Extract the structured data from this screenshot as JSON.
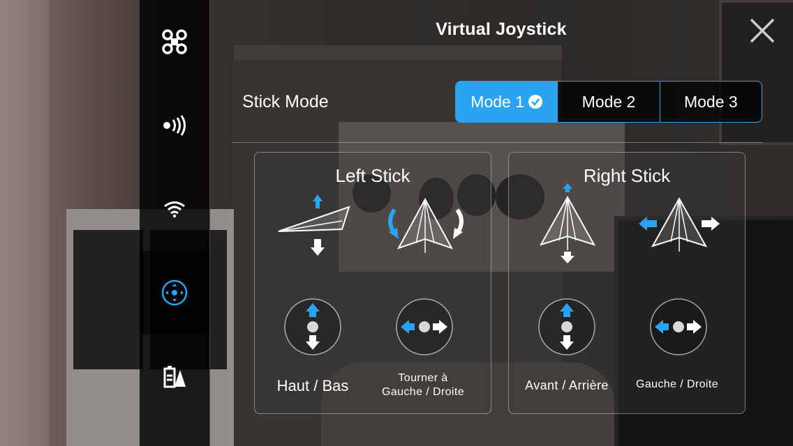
{
  "header": {
    "title": "Virtual Joystick"
  },
  "stick_mode": {
    "label": "Stick Mode",
    "options": [
      "Mode 1",
      "Mode 2",
      "Mode 3"
    ],
    "selected": "Mode 1"
  },
  "left_stick": {
    "title": "Left Stick",
    "vertical_label": "Haut / Bas",
    "horizontal_label_line1": "Tourner à",
    "horizontal_label_line2": "Gauche / Droite"
  },
  "right_stick": {
    "title": "Right Stick",
    "vertical_label": "Avant / Arrière",
    "horizontal_label": "Gauche / Droite"
  },
  "sidebar": {
    "items": [
      {
        "icon": "drone-icon"
      },
      {
        "icon": "signal-icon"
      },
      {
        "icon": "wifi-icon"
      },
      {
        "icon": "joystick-icon",
        "active": true
      },
      {
        "icon": "battery-icon"
      }
    ]
  },
  "colors": {
    "accent": "#2aa3f0"
  }
}
